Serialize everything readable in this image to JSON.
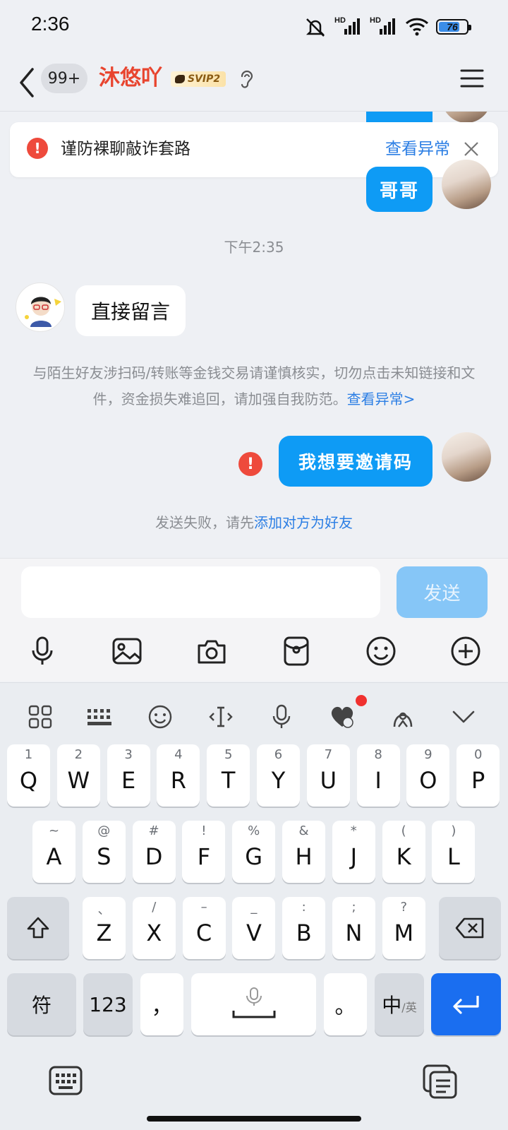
{
  "status_bar": {
    "time": "2:36",
    "network_1": "HD",
    "network_2": "HD",
    "battery": "76",
    "battery_level": 0.76
  },
  "header": {
    "unread_count": "99+",
    "contact_name": "沐悠吖",
    "vip_badge": "SVIP2"
  },
  "warning_banner": {
    "text": "谨防裸聊敲诈套路",
    "link": "查看异常"
  },
  "chat": {
    "partial_bubble_text": "哥哥",
    "time_label": "下午2:35",
    "incoming_message": "直接留言",
    "safety_tip": "与陌生好友涉扫码/转账等金钱交易请谨慎核实，切勿点击未知链接和文件，资金损失难追回，请加强自我防范。",
    "safety_tip_link": "查看异常>",
    "outgoing_message": "我想要邀请码",
    "send_fail_text": "发送失败，请先",
    "send_fail_link": "添加对方为好友"
  },
  "composer": {
    "input_value": "",
    "send_label": "发送"
  },
  "keyboard": {
    "row1": [
      {
        "main": "Q",
        "sub": "1"
      },
      {
        "main": "W",
        "sub": "2"
      },
      {
        "main": "E",
        "sub": "3"
      },
      {
        "main": "R",
        "sub": "4"
      },
      {
        "main": "T",
        "sub": "5"
      },
      {
        "main": "Y",
        "sub": "6"
      },
      {
        "main": "U",
        "sub": "7"
      },
      {
        "main": "I",
        "sub": "8"
      },
      {
        "main": "O",
        "sub": "9"
      },
      {
        "main": "P",
        "sub": "0"
      }
    ],
    "row2": [
      {
        "main": "A",
        "sub": "~"
      },
      {
        "main": "S",
        "sub": "@"
      },
      {
        "main": "D",
        "sub": "#"
      },
      {
        "main": "F",
        "sub": "!"
      },
      {
        "main": "G",
        "sub": "%"
      },
      {
        "main": "H",
        "sub": "&"
      },
      {
        "main": "J",
        "sub": "*"
      },
      {
        "main": "K",
        "sub": "("
      },
      {
        "main": "L",
        "sub": ")"
      }
    ],
    "row3": [
      {
        "main": "Z",
        "sub": "、"
      },
      {
        "main": "X",
        "sub": "/"
      },
      {
        "main": "C",
        "sub": "–"
      },
      {
        "main": "V",
        "sub": "_"
      },
      {
        "main": "B",
        "sub": ":"
      },
      {
        "main": "N",
        "sub": ";"
      },
      {
        "main": "M",
        "sub": "?"
      }
    ],
    "symbols_key": "符",
    "numbers_key": "123",
    "comma_key": "，",
    "period_key": "。",
    "lang_key_main": "中",
    "lang_key_sub": "/英"
  }
}
